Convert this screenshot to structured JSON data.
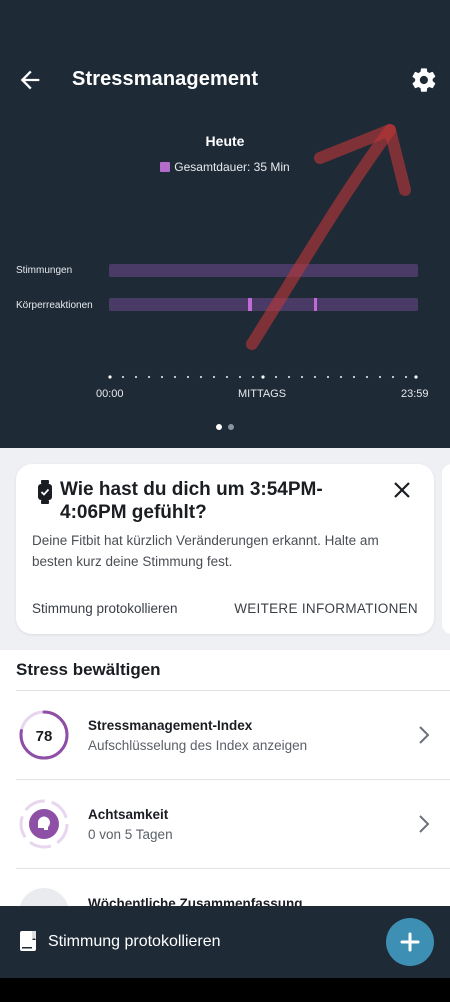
{
  "header": {
    "title": "Stressmanagement"
  },
  "chart": {
    "heading": "Heute",
    "legend_label": "Gesamtdauer: 35 Min",
    "legend_color": "#b36cc9",
    "rows": [
      "Stimmungen",
      "Körperreaktionen"
    ],
    "time_labels": [
      "00:00",
      "MITTAGS",
      "23:59"
    ]
  },
  "chart_data": {
    "type": "bar",
    "categories": [
      "Stimmungen",
      "Körperreaktionen"
    ],
    "title": "Heute",
    "legend": [
      "Gesamtdauer: 35 Min"
    ],
    "x_ticks": [
      "00:00",
      "MITTAGS",
      "23:59"
    ],
    "series": [
      {
        "name": "Stimmungen",
        "events": []
      },
      {
        "name": "Körperreaktionen",
        "events": [
          "≈10:30",
          "≈14:45"
        ]
      }
    ]
  },
  "card": {
    "title": "Wie hast du dich um 3:54PM-4:06PM gefühlt?",
    "body": "Deine Fitbit hat kürzlich Veränderungen erkannt. Halte am besten kurz deine Stimmung fest.",
    "action_log": "Stimmung protokollieren",
    "action_info": "WEITERE INFORMATIONEN"
  },
  "section": {
    "title": "Stress bewältigen",
    "items": [
      {
        "title": "Stressmanagement-Index",
        "subtitle": "Aufschlüsselung des Index anzeigen",
        "value": "78",
        "score": 0.78
      },
      {
        "title": "Achtsamkeit",
        "subtitle": "0 von 5 Tagen"
      },
      {
        "title": "Wöchentliche Zusammenfassung",
        "subtitle": ""
      }
    ]
  },
  "bottom": {
    "label": "Stimmung protokollieren"
  },
  "colors": {
    "hero": "#1e2a36",
    "accent": "#b36cc9",
    "fab": "#3d8fb3"
  }
}
